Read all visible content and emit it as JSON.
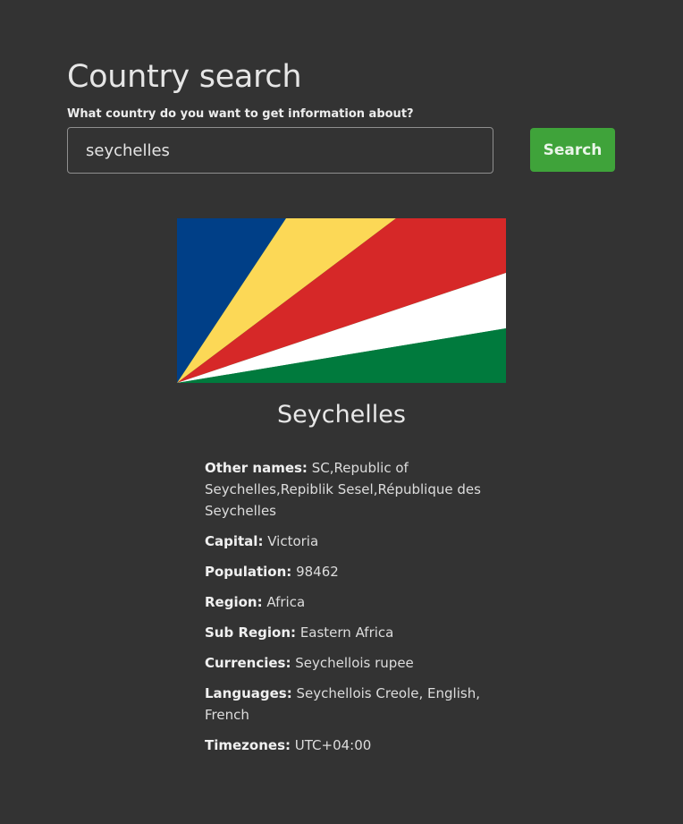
{
  "header": {
    "title": "Country search",
    "prompt": "What country do you want to get information about?"
  },
  "search": {
    "value": "seychelles",
    "button_label": "Search"
  },
  "country": {
    "name": "Seychelles",
    "flag_colors": {
      "blue": "#003f87",
      "yellow": "#fcd856",
      "red": "#d62828",
      "white": "#ffffff",
      "green": "#007a3d"
    },
    "details": [
      {
        "label": "Other names:",
        "value": "SC,Republic of Seychelles,Repiblik Sesel,République des Seychelles"
      },
      {
        "label": "Capital:",
        "value": "Victoria"
      },
      {
        "label": "Population:",
        "value": "98462"
      },
      {
        "label": "Region:",
        "value": "Africa"
      },
      {
        "label": "Sub Region:",
        "value": "Eastern Africa"
      },
      {
        "label": "Currencies:",
        "value": "Seychellois rupee"
      },
      {
        "label": "Languages:",
        "value": "Seychellois Creole, English, French"
      },
      {
        "label": "Timezones:",
        "value": "UTC+04:00"
      }
    ]
  }
}
